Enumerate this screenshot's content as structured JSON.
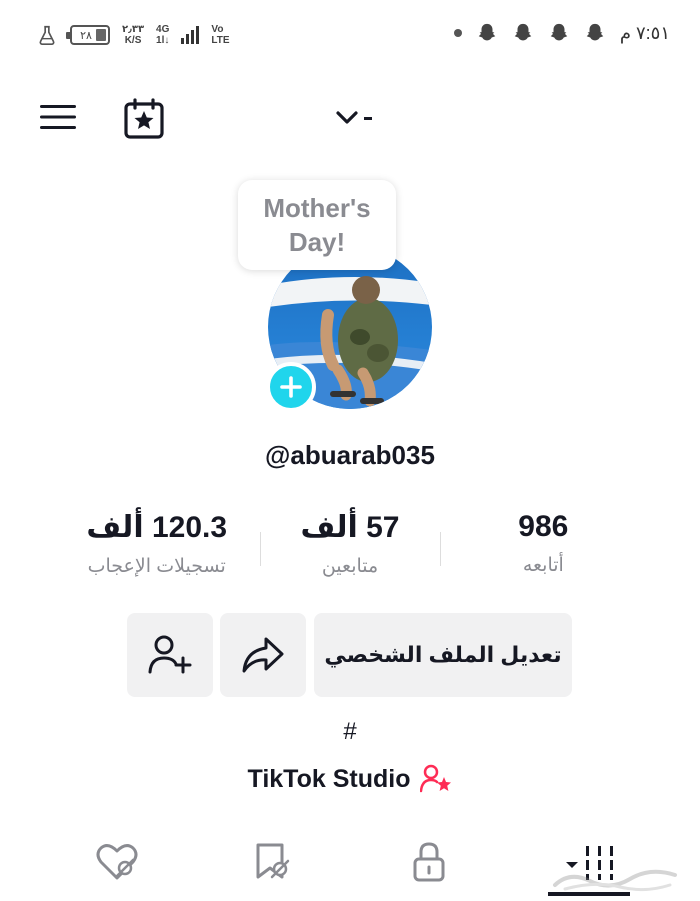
{
  "status_bar": {
    "time": "٧:٥١ م",
    "battery": "٢٨",
    "net_speed_value": "٢٫٣٣",
    "net_speed_unit": "K/S",
    "network": "4G",
    "network_sub": "1l↓",
    "volte_top": "Vo",
    "volte_bottom": "LTE",
    "notification_icons": [
      "snapchat-ghost-icon",
      "snapchat-ghost-icon",
      "snapchat-ghost-icon",
      "snapchat-ghost-icon"
    ]
  },
  "top_nav": {
    "menu_icon": "hamburger-menu-icon",
    "calendar_icon": "calendar-star-icon",
    "account_switch_icon": "chevron-down-icon"
  },
  "profile": {
    "bubble_line1": "Mother's",
    "bubble_line2": "Day!",
    "username": "@abuarab035",
    "add_photo_icon": "plus-icon"
  },
  "stats": [
    {
      "value": "986",
      "label": "أتابعه"
    },
    {
      "value": "57 ألف",
      "label": "متابعين"
    },
    {
      "value": "120.3 ألف",
      "label": "تسجيلات الإعجاب"
    }
  ],
  "actions": {
    "edit_profile": "تعديل الملف الشخصي",
    "share_icon": "share-arrow-icon",
    "add_friend_icon": "add-friend-icon"
  },
  "bio": {
    "hashtag": "#",
    "studio_label": "TikTok Studio"
  },
  "tabs": [
    {
      "icon": "grid-videos-icon",
      "active": true
    },
    {
      "icon": "lock-icon",
      "active": false
    },
    {
      "icon": "bookmark-hidden-icon",
      "active": false
    },
    {
      "icon": "liked-hidden-icon",
      "active": false
    }
  ],
  "colors": {
    "accent": "#20d5ec",
    "studio_pink": "#fe2c55",
    "button_bg": "#f1f1f2",
    "muted_text": "#8a8b91"
  }
}
